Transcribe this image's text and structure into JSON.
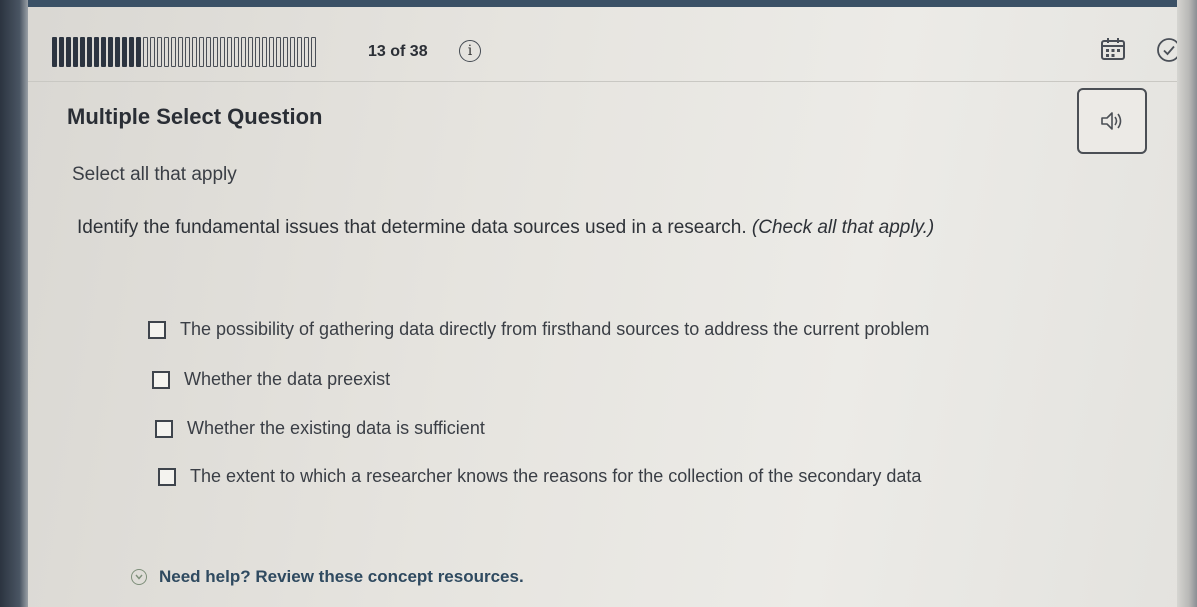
{
  "progress": {
    "label": "13 of 38",
    "current": 13,
    "total": 38
  },
  "header": {
    "info_icon": "info-icon",
    "calendar_icon": "calendar-icon",
    "check_icon": "check-circle-icon"
  },
  "audio": {
    "icon": "speaker-icon"
  },
  "question": {
    "type": "Multiple Select Question",
    "instruction": "Select all that apply",
    "prompt": "Identify the fundamental issues that determine data sources used in a research.",
    "prompt_suffix": "(Check all that apply.)",
    "options": [
      {
        "label": "The possibility of gathering data directly from firsthand sources to address the current problem",
        "checked": false
      },
      {
        "label": "Whether the data preexist",
        "checked": false
      },
      {
        "label": "Whether the existing data is sufficient",
        "checked": false
      },
      {
        "label": "The extent to which a researcher knows the reasons for the collection of the secondary data",
        "checked": false
      }
    ]
  },
  "help": {
    "label": "Need help? Review these concept resources.",
    "icon": "chevron-down-icon"
  }
}
